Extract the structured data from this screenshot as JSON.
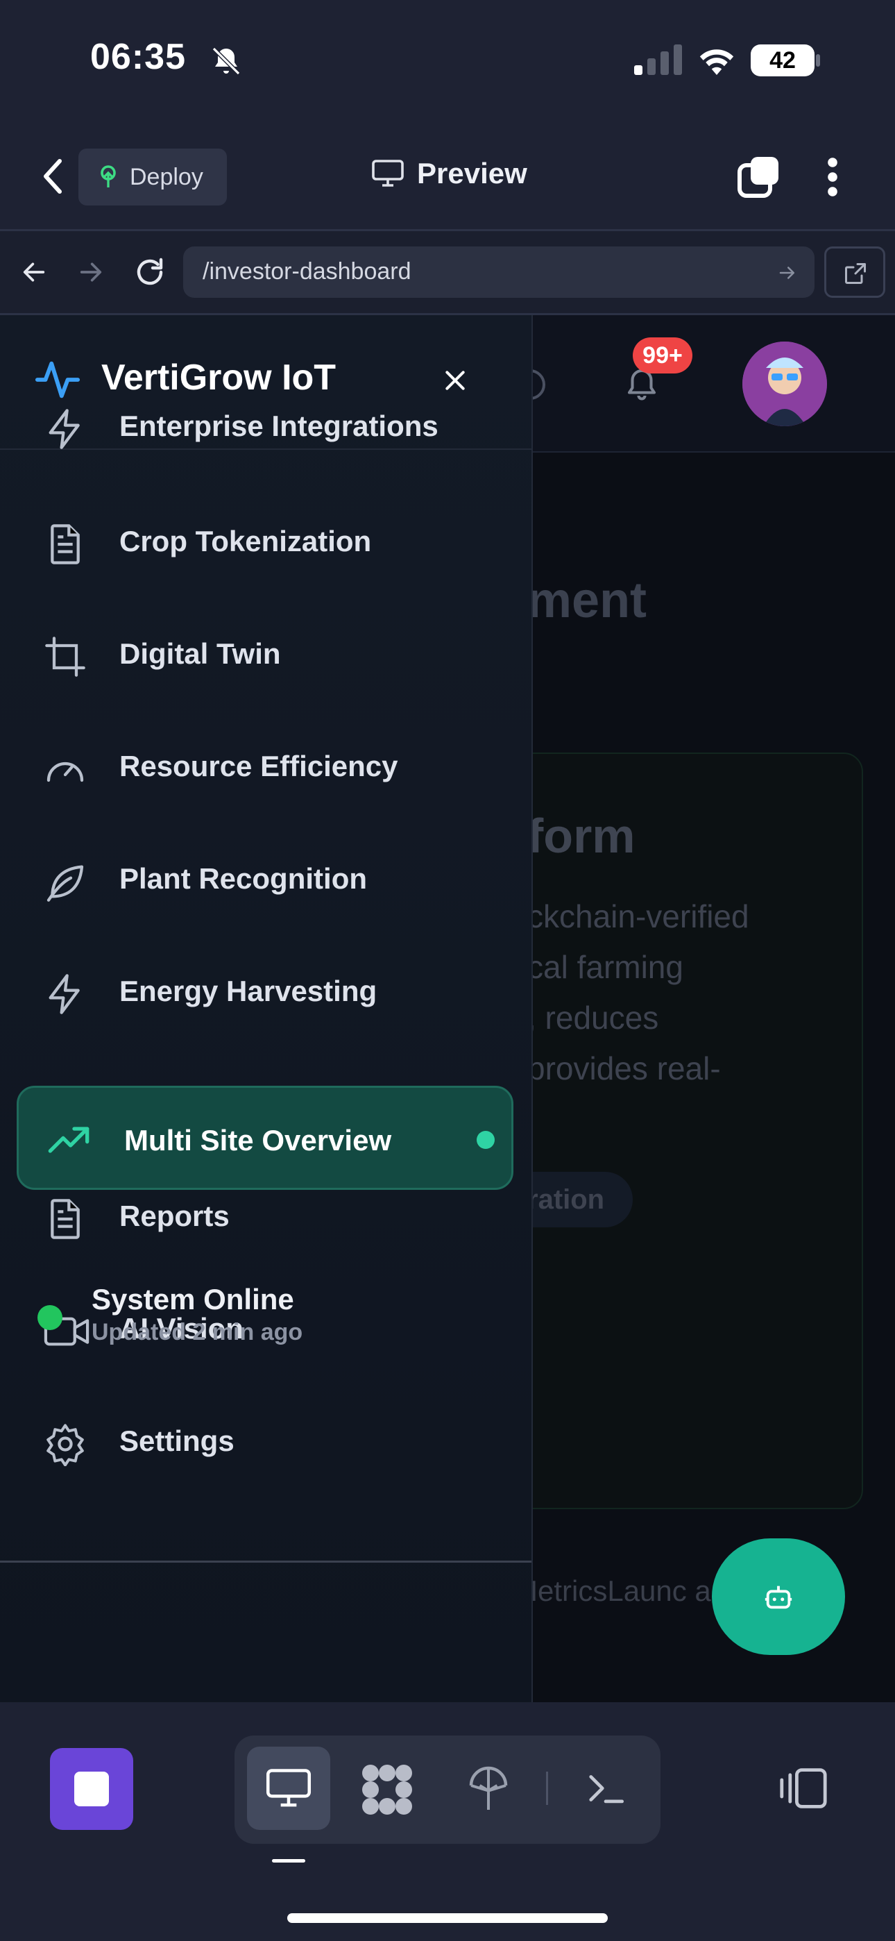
{
  "status_bar": {
    "time": "06:35",
    "battery": "42"
  },
  "header": {
    "deploy_label": "Deploy",
    "preview_label": "Preview"
  },
  "url_bar": {
    "url": "/investor-dashboard"
  },
  "background": {
    "notification_badge": "99+",
    "heading_fragment": "ment",
    "card_title_fragment": "form",
    "card_description": "ckchain-verified\ncal farming\n, reduces\nprovides real-",
    "pill_fragment": "ration",
    "tabs_fragment": "MetricsLaunc      ap"
  },
  "sidebar": {
    "brand": "VertiGrow IoT",
    "items": [
      {
        "label": "Enterprise Integrations",
        "icon": "lightning-icon"
      },
      {
        "label": "Crop Tokenization",
        "icon": "document-icon"
      },
      {
        "label": "Digital Twin",
        "icon": "crop-icon"
      },
      {
        "label": "Resource Efficiency",
        "icon": "gauge-icon"
      },
      {
        "label": "Plant Recognition",
        "icon": "leaf-icon"
      },
      {
        "label": "Energy Harvesting",
        "icon": "lightning-icon"
      },
      {
        "label": "Multi Site Overview",
        "icon": "trending-up-icon",
        "active": true
      },
      {
        "label": "Reports",
        "icon": "document-icon"
      },
      {
        "label": "AI Vision",
        "icon": "video-icon"
      },
      {
        "label": "Settings",
        "icon": "gear-icon"
      }
    ],
    "footer": {
      "status": "System Online",
      "updated": "Updated 2 min ago"
    }
  },
  "colors": {
    "accent": "#2fd3a4",
    "active_bg": "#134a42",
    "online": "#22c55e",
    "stop": "#6a45d8",
    "badge": "#ef4444"
  }
}
